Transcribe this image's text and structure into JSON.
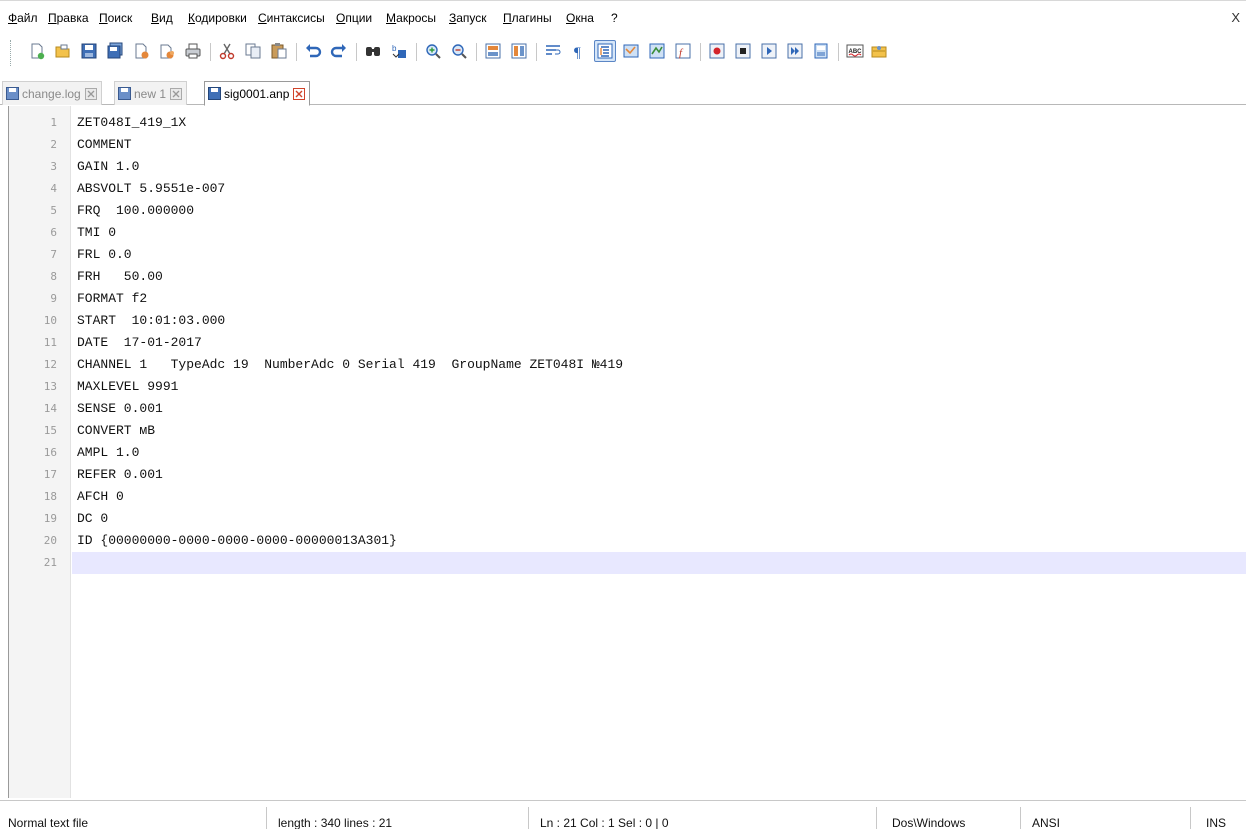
{
  "window": {
    "close_glyph": "X"
  },
  "menu": [
    "Файл",
    "Правка",
    "Поиск",
    "Вид",
    "Кодировки",
    "Синтаксисы",
    "Опции",
    "Макросы",
    "Запуск",
    "Плагины",
    "Окна",
    "?"
  ],
  "toolbar": {
    "icons": [
      "new-file-icon",
      "open-file-icon",
      "save-icon",
      "save-all-icon",
      "close-file-icon",
      "close-all-icon",
      "print-icon",
      "cut-icon",
      "copy-icon",
      "paste-icon",
      "undo-icon",
      "redo-icon",
      "find-icon",
      "replace-icon",
      "zoom-in-icon",
      "zoom-out-icon",
      "sync-vertical-icon",
      "sync-horizontal-icon",
      "word-wrap-icon",
      "show-all-chars-icon",
      "indent-guide-icon",
      "doc-map-icon",
      "function-list-icon",
      "folder-workspace-icon",
      "record-macro-icon",
      "stop-recording-icon",
      "play-macro-icon",
      "run-macro-multiple-icon",
      "save-macro-icon",
      "spell-check-icon",
      "settings-plugin-icon"
    ],
    "accent": "#1e5fb4",
    "active_color": "#d6e6f8"
  },
  "tabs": [
    {
      "label": "change.log",
      "state": "inactive"
    },
    {
      "label": "new  1",
      "state": "inactive"
    },
    {
      "label": "sig0001.anp",
      "state": "active"
    }
  ],
  "editor": {
    "lines": [
      {
        "n": "1",
        "text": "ZET048I_419_1X"
      },
      {
        "n": "2",
        "text": "COMMENT"
      },
      {
        "n": "3",
        "text": "GAIN 1.0"
      },
      {
        "n": "4",
        "text": "ABSVOLT 5.9551e-007"
      },
      {
        "n": "5",
        "text": "FRQ  100.000000"
      },
      {
        "n": "6",
        "text": "TMI 0"
      },
      {
        "n": "7",
        "text": "FRL 0.0"
      },
      {
        "n": "8",
        "text": "FRH   50.00"
      },
      {
        "n": "9",
        "text": "FORMAT f2"
      },
      {
        "n": "10",
        "text": "START  10:01:03.000"
      },
      {
        "n": "11",
        "text": "DATE  17-01-2017"
      },
      {
        "n": "12",
        "text": "CHANNEL 1   TypeAdc 19  NumberAdc 0 Serial 419  GroupName ZET048I №419"
      },
      {
        "n": "13",
        "text": "MAXLEVEL 9991"
      },
      {
        "n": "14",
        "text": "SENSE 0.001"
      },
      {
        "n": "15",
        "text": "CONVERT мВ"
      },
      {
        "n": "16",
        "text": "AMPL 1.0"
      },
      {
        "n": "17",
        "text": "REFER 0.001"
      },
      {
        "n": "18",
        "text": "AFCH 0"
      },
      {
        "n": "19",
        "text": "DC 0"
      },
      {
        "n": "20",
        "text": "ID {00000000-0000-0000-0000-00000013A301}"
      },
      {
        "n": "21",
        "text": ""
      }
    ],
    "current_line": 21,
    "current_line_color": "#e8e8ff"
  },
  "status": {
    "file_type": "Normal text file",
    "length_lines": "length : 340   lines : 21",
    "position": "Ln : 21   Col : 1   Sel : 0 | 0",
    "eol": "Dos\\Windows",
    "encoding": "ANSI",
    "mode": "INS"
  }
}
